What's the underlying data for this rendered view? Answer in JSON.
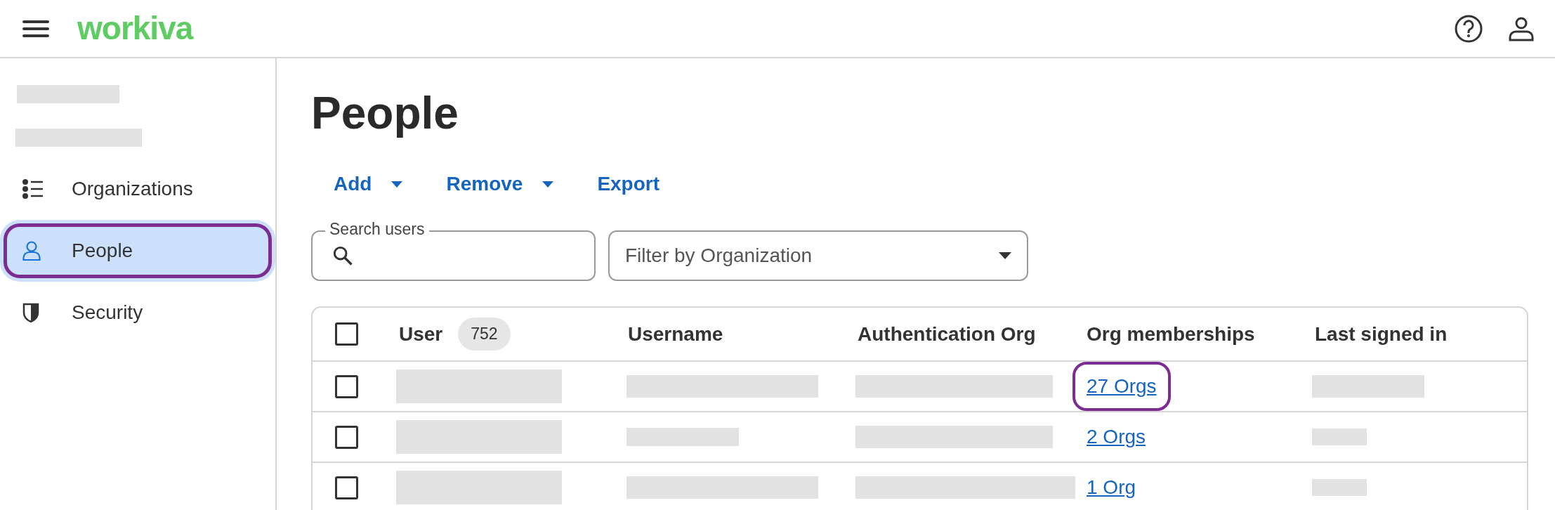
{
  "header": {
    "logo": "workiva"
  },
  "sidebar": {
    "items": [
      {
        "label": "Organizations",
        "selected": false,
        "annotated": false
      },
      {
        "label": "People",
        "selected": true,
        "annotated": true
      },
      {
        "label": "Security",
        "selected": false,
        "annotated": false
      }
    ]
  },
  "page": {
    "title": "People"
  },
  "toolbar": [
    {
      "label": "Add",
      "dropdown": true
    },
    {
      "label": "Remove",
      "dropdown": true
    },
    {
      "label": "Export",
      "dropdown": false
    }
  ],
  "search": {
    "label": "Search users"
  },
  "filter": {
    "placeholder": "Filter by Organization"
  },
  "table": {
    "checked": false,
    "user_count": "752",
    "columns": [
      "User",
      "Username",
      "Authentication Org",
      "Org memberships",
      "Last signed in"
    ],
    "rows": [
      {
        "checked": false,
        "org_memberships": "27 Orgs",
        "annotated": true
      },
      {
        "checked": false,
        "org_memberships": "2 Orgs",
        "annotated": false
      },
      {
        "checked": false,
        "org_memberships": "1 Org",
        "annotated": false
      }
    ]
  }
}
